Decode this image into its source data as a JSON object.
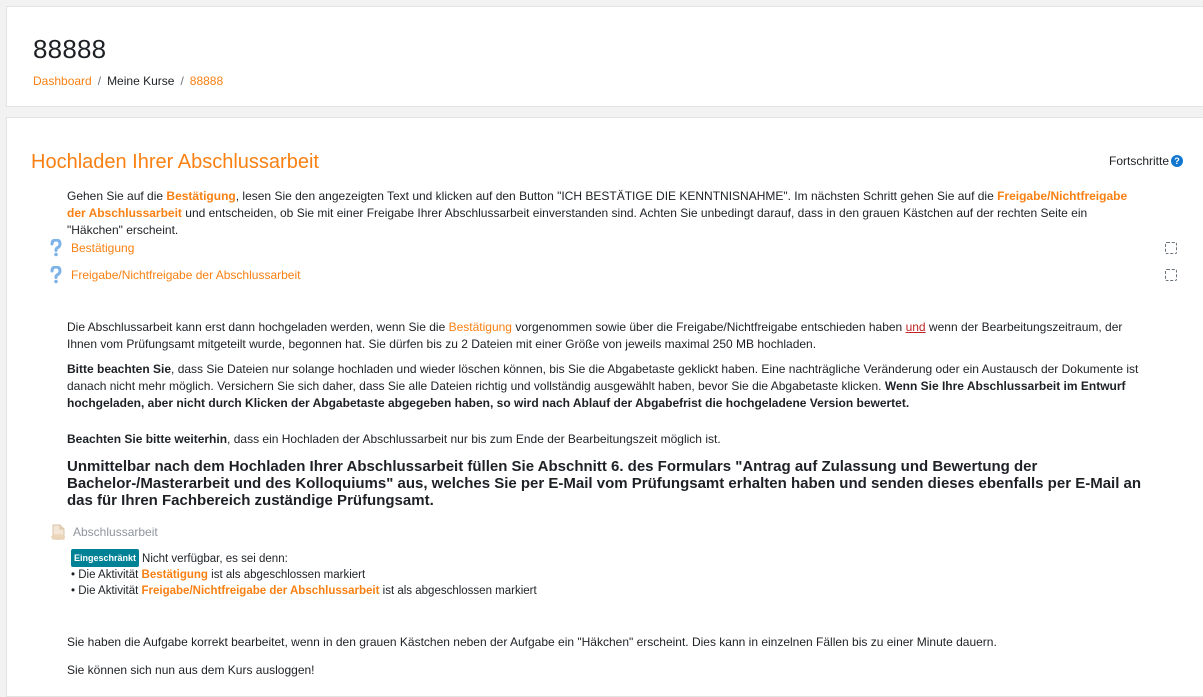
{
  "header": {
    "title": "88888",
    "breadcrumb": {
      "dashboard": "Dashboard",
      "separator": "/",
      "my_courses": "Meine Kurse",
      "course": "88888"
    }
  },
  "section": {
    "title": "Hochladen Ihrer Abschlussarbeit",
    "progress_label": "Fortschritte",
    "progress_help_icon": "question-circle-icon"
  },
  "intro": {
    "part1": "Gehen Sie auf die ",
    "link1": "Bestätigung",
    "part2": ", lesen Sie den angezeigten Text und klicken auf den Button \"ICH BESTÄTIGE DIE KENNTNISNAHME\". Im nächsten Schritt gehen Sie auf die ",
    "link2": "Freigabe/Nichtfreigabe der Abschlussarbeit",
    "part3": " und entscheiden, ob Sie mit einer Freigabe Ihrer Abschlussarbeit einverstanden sind. Achten Sie unbedingt darauf, dass in den grauen Kästchen auf der rechten Seite ein \"Häkchen\" erscheint."
  },
  "activities": [
    {
      "label": "Bestätigung",
      "icon": "question-mark-icon"
    },
    {
      "label": "Freigabe/Nichtfreigabe der Abschlussarbeit",
      "icon": "question-mark-icon"
    }
  ],
  "info1": {
    "part1": "Die Abschlussarbeit kann erst dann hochgeladen werden, wenn Sie die ",
    "link": "Bestätigung",
    "part2": " vorgenommen sowie über die Freigabe/Nichtfreigabe entschieden haben ",
    "und": "und",
    "part3": " wenn der Bearbeitungszeitraum, der Ihnen vom Prüfungsamt mitgeteilt wurde, begonnen hat. Sie dürfen bis zu 2 Dateien mit einer Größe von jeweils maximal 250 MB hochladen."
  },
  "info2": {
    "bold1": "Bitte beachten Sie",
    "part1": ", dass Sie Dateien nur solange hochladen und wieder löschen können, bis Sie die Abgabetaste geklickt haben. Eine nachträgliche Veränderung oder ein Austausch der Dokumente ist danach nicht mehr möglich. Versichern Sie sich daher, dass Sie alle Dateien richtig und vollständig ausgewählt haben, bevor Sie die Abgabetaste klicken. ",
    "bold2": "Wenn Sie Ihre Abschlussarbeit im Entwurf hochgeladen, aber nicht durch Klicken der Abgabetaste abgegeben haben, so wird nach Ablauf der Abgabefrist die hochgeladene Version bewertet."
  },
  "info3": {
    "bold": "Beachten Sie bitte weiterhin",
    "part": ", dass ein Hochladen der Abschlussarbeit nur bis zum Ende der Bearbeitungszeit möglich ist."
  },
  "big_heading": "Unmittelbar nach dem Hochladen Ihrer Abschlussarbeit füllen Sie Abschnitt 6. des Formulars \"Antrag auf Zulassung und Bewertung der Bachelor-/Masterarbeit und des Kolloquiums\" aus, welches Sie per E-Mail vom Prüfungsamt erhalten haben und senden dieses ebenfalls per E-Mail an das für Ihren Fachbereich zuständige Prüfungsamt.",
  "assignment": {
    "label": "Abschlussarbeit",
    "icon": "assignment-file-icon"
  },
  "restriction": {
    "badge": "Eingeschränkt",
    "text": "Nicht verfügbar, es sei denn:",
    "items": [
      {
        "prefix": "Die Aktivität ",
        "link": "Bestätigung",
        "suffix": " ist als abgeschlossen markiert"
      },
      {
        "prefix": "Die Aktivität ",
        "link": "Freigabe/Nichtfreigabe der Abschlussarbeit",
        "suffix": " ist als abgeschlossen markiert"
      }
    ]
  },
  "final1": "Sie haben die Aufgabe korrekt bearbeitet, wenn in den grauen Kästchen neben der Aufgabe ein \"Häkchen\" erscheint. Dies kann in einzelnen Fällen bis zu einer Minute dauern.",
  "final2": "Sie können sich nun aus dem Kurs ausloggen!",
  "colors": {
    "accent": "#f98012",
    "badge": "#008196",
    "help_icon": "#1177d1"
  }
}
